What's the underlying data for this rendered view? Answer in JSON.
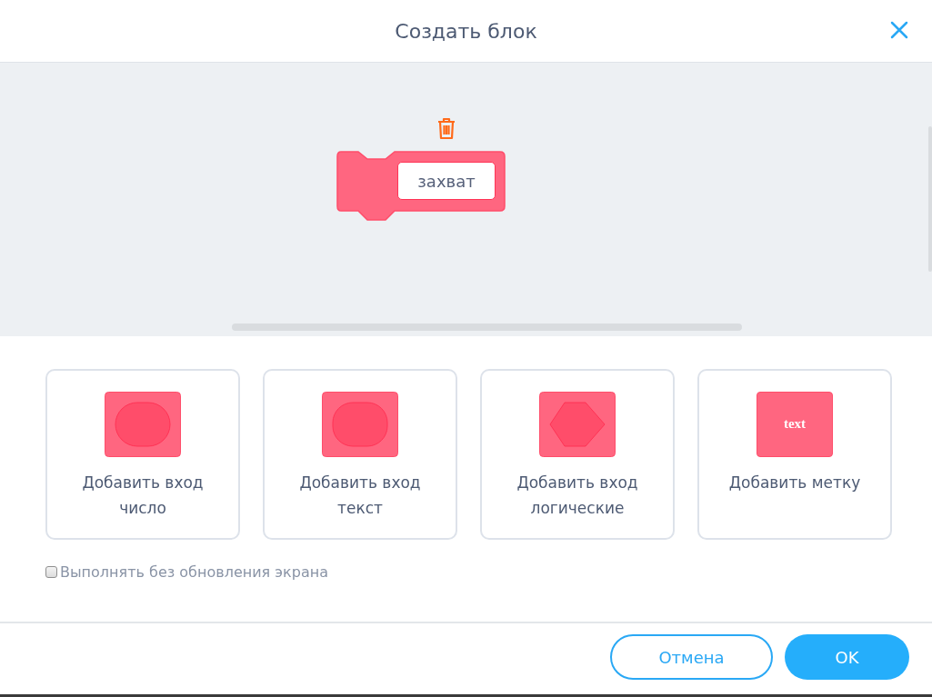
{
  "window": {
    "title": "Создать блок"
  },
  "block": {
    "field_value": "захват"
  },
  "options": [
    {
      "kind": "number",
      "label": "Добавить вход\nчисло"
    },
    {
      "kind": "text",
      "label": "Добавить вход\nтекст"
    },
    {
      "kind": "boolean",
      "label": "Добавить вход\nлогические"
    },
    {
      "kind": "label",
      "label": "Добавить метку",
      "icon_text": "text"
    }
  ],
  "run_without_refresh": {
    "label": "Выполнять без обновления экрана",
    "checked": false
  },
  "buttons": [
    {
      "kind": "cancel",
      "label": "Отмена"
    },
    {
      "kind": "ok",
      "label": "OK"
    }
  ]
}
